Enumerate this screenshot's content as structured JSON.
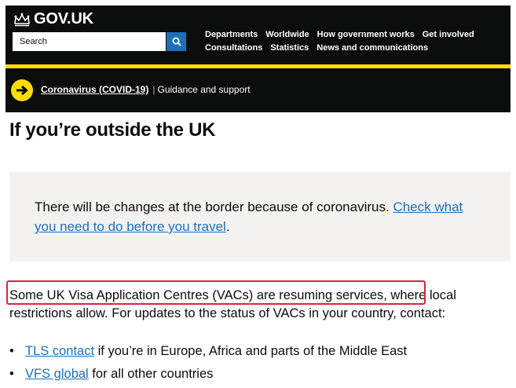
{
  "header": {
    "logo_text": "GOV.UK",
    "search_placeholder": "Search",
    "nav_row1": [
      "Departments",
      "Worldwide",
      "How government works",
      "Get involved"
    ],
    "nav_row2": [
      "Consultations",
      "Statistics",
      "News and communications"
    ]
  },
  "banner": {
    "link_text": "Coronavirus (COVID-19)",
    "separator": "|",
    "support_text": "Guidance and support"
  },
  "page": {
    "title": "If you’re outside the UK",
    "inset": {
      "text": "There will be changes at the border because of coronavirus. ",
      "link": "Check what you need to do before you travel",
      "end": "."
    },
    "paragraph": {
      "highlighted": "Some UK Visa Application Centres (VACs) are resuming services",
      "rest": ", where local restrictions allow. For updates to the status of VACs in your country, contact:"
    },
    "list": [
      {
        "link": "TLS contact",
        "text": " if you’re in Europe, Africa and parts of the Middle East"
      },
      {
        "link": "VFS global",
        "text": " for all other countries"
      }
    ]
  },
  "colors": {
    "header_bg": "#0b0c0c",
    "accent_yellow": "#ffdd00",
    "link_blue": "#1d70b8",
    "inset_bg": "#f3f2f1",
    "highlight_red": "#d7263d"
  }
}
